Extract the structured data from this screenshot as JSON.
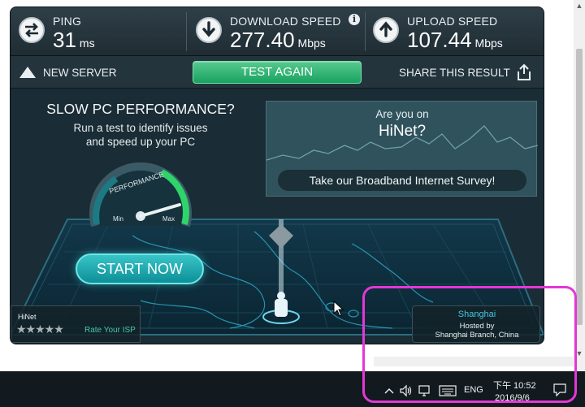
{
  "stats": {
    "ping": {
      "label": "PING",
      "value": "31",
      "unit": "ms",
      "icon": "ping-icon"
    },
    "download": {
      "label": "DOWNLOAD SPEED",
      "value": "277.40",
      "unit": "Mbps",
      "icon": "download-arrow-icon",
      "info": "i"
    },
    "upload": {
      "label": "UPLOAD SPEED",
      "value": "107.44",
      "unit": "Mbps",
      "icon": "upload-arrow-icon"
    }
  },
  "toolbar": {
    "new_server": "NEW SERVER",
    "test_again": "TEST AGAIN",
    "share": "SHARE THIS RESULT"
  },
  "ad": {
    "title": "SLOW PC PERFORMANCE?",
    "line1": "Run a test to identify issues",
    "line2": "and speed up your PC",
    "gauge_label": "PERFORMANCE",
    "gauge_min": "Min",
    "gauge_max": "Max",
    "start_now": "START NOW"
  },
  "survey": {
    "question": "Are you on",
    "isp": "HiNet?",
    "button": "Take our Broadband Internet Survey!"
  },
  "isp_box": {
    "name": "HiNet",
    "stars": "★★★★★",
    "rate": "Rate Your ISP"
  },
  "server_box": {
    "city": "Shanghai",
    "hosted": "Hosted by",
    "branch": "Shanghai Branch, China"
  },
  "taskbar": {
    "lang": "ENG",
    "time": "下午 10:52",
    "date": "2016/9/6"
  },
  "colors": {
    "accent_green": "#17a261",
    "highlight": "#e437d6",
    "map_cyan": "#2fb6d6"
  }
}
